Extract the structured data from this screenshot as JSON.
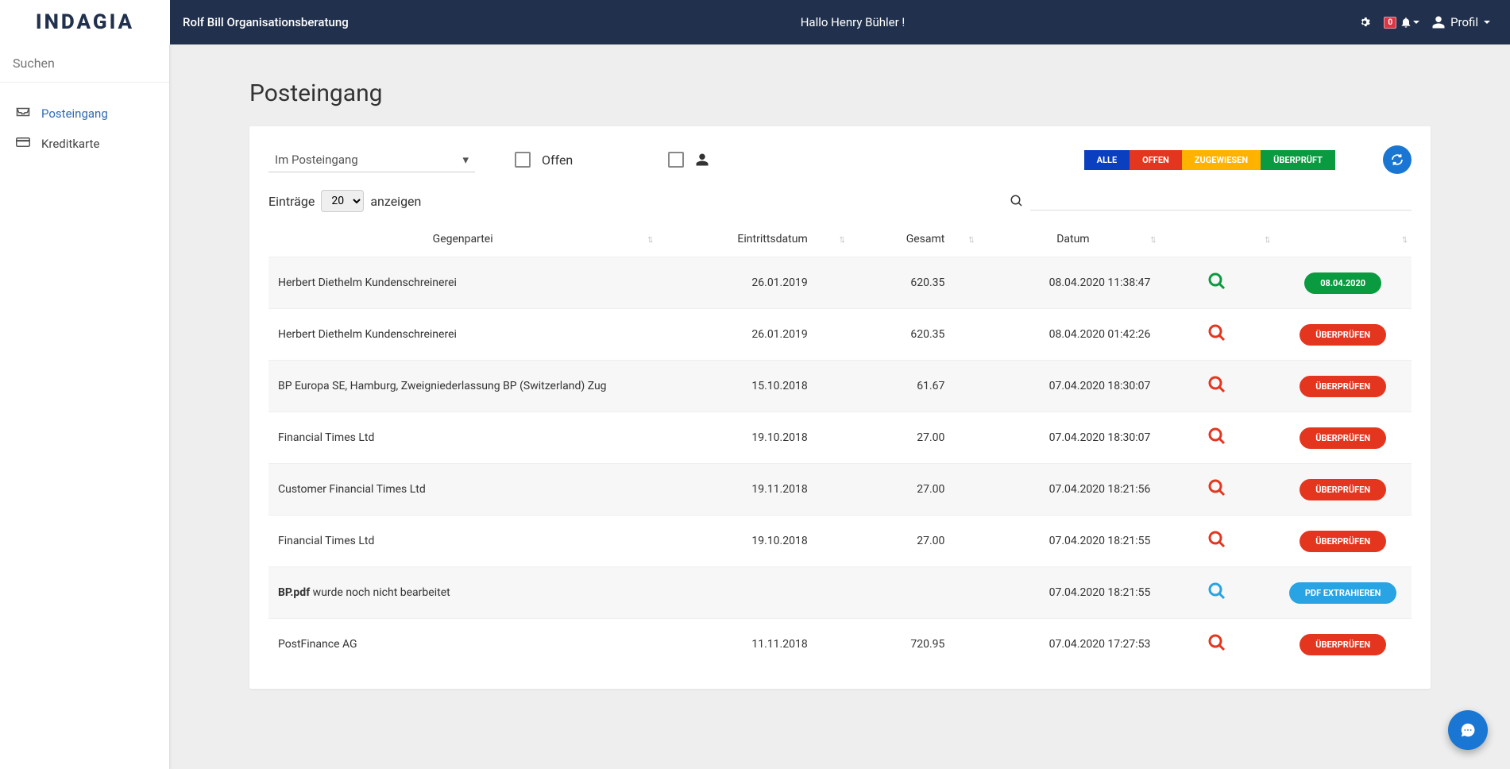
{
  "header": {
    "brand": "INDAGIA",
    "org": "Rolf Bill Organisationsberatung",
    "greeting": "Hallo Henry Bühler !",
    "notify_count": "0",
    "profile_label": "Profil"
  },
  "sidebar": {
    "search_placeholder": "Suchen",
    "items": [
      {
        "label": "Posteingang",
        "active": true,
        "icon": "inbox"
      },
      {
        "label": "Kreditkarte",
        "active": false,
        "icon": "card"
      }
    ]
  },
  "page": {
    "title": "Posteingang",
    "filter_selected": "Im Posteingang",
    "filter_offen_label": "Offen",
    "pills": {
      "alle": "ALLE",
      "offen": "OFFEN",
      "zugewiesen": "ZUGEWIESEN",
      "ueberprueft": "ÜBERPRÜFT"
    },
    "entries_label": "Einträge",
    "entries_value": "20",
    "entries_suffix": "anzeigen",
    "columns": {
      "gegenpartei": "Gegenpartei",
      "eintrittsdatum": "Eintrittsdatum",
      "gesamt": "Gesamt",
      "datum": "Datum"
    },
    "rows": [
      {
        "gegenpartei": "Herbert Diethelm Kundenschreinerei",
        "eintritt": "26.01.2019",
        "gesamt": "620.35",
        "datum": "08.04.2020 11:38:47",
        "action": "08.04.2020",
        "action_type": "green",
        "view_color": "#0a9a3f"
      },
      {
        "gegenpartei": "Herbert Diethelm Kundenschreinerei",
        "eintritt": "26.01.2019",
        "gesamt": "620.35",
        "datum": "08.04.2020 01:42:26",
        "action": "ÜBERPRÜFEN",
        "action_type": "red",
        "view_color": "#e4361f"
      },
      {
        "gegenpartei": "BP Europa SE, Hamburg, Zweigniederlassung BP (Switzerland) Zug",
        "eintritt": "15.10.2018",
        "gesamt": "61.67",
        "datum": "07.04.2020 18:30:07",
        "action": "ÜBERPRÜFEN",
        "action_type": "red",
        "view_color": "#e4361f"
      },
      {
        "gegenpartei": "Financial Times Ltd",
        "eintritt": "19.10.2018",
        "gesamt": "27.00",
        "datum": "07.04.2020 18:30:07",
        "action": "ÜBERPRÜFEN",
        "action_type": "red",
        "view_color": "#e4361f"
      },
      {
        "gegenpartei": "Customer Financial Times Ltd",
        "eintritt": "19.11.2018",
        "gesamt": "27.00",
        "datum": "07.04.2020 18:21:56",
        "action": "ÜBERPRÜFEN",
        "action_type": "red",
        "view_color": "#e4361f"
      },
      {
        "gegenpartei": "Financial Times Ltd",
        "eintritt": "19.10.2018",
        "gesamt": "27.00",
        "datum": "07.04.2020 18:21:55",
        "action": "ÜBERPRÜFEN",
        "action_type": "red",
        "view_color": "#e4361f"
      },
      {
        "special": "BP.pdf",
        "special_text": " wurde noch nicht bearbeitet",
        "eintritt": "",
        "gesamt": "",
        "datum": "07.04.2020 18:21:55",
        "action": "PDF EXTRAHIEREN",
        "action_type": "blue",
        "view_color": "#28a3e3"
      },
      {
        "gegenpartei": "PostFinance AG",
        "eintritt": "11.11.2018",
        "gesamt": "720.95",
        "datum": "07.04.2020 17:27:53",
        "action": "ÜBERPRÜFEN",
        "action_type": "red",
        "view_color": "#e4361f"
      }
    ]
  }
}
